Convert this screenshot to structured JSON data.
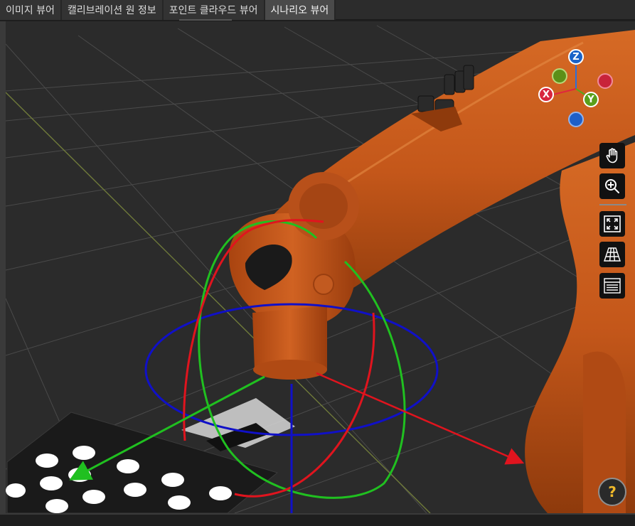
{
  "tabs": [
    {
      "label": "이미지 뷰어",
      "active": false
    },
    {
      "label": "캘리브레이션 원 정보",
      "active": false
    },
    {
      "label": "포인트 클라우드 뷰어",
      "active": false
    },
    {
      "label": "시나리오 뷰어",
      "active": true
    }
  ],
  "gizmo": {
    "z_label": "Z",
    "x_label": "X",
    "y_label": "Y"
  },
  "toolbar": [
    {
      "name": "pan-tool-button",
      "icon": "hand-icon"
    },
    {
      "name": "zoom-tool-button",
      "icon": "zoom-in-icon"
    },
    {
      "name": "fit-view-button",
      "icon": "fit-screen-icon"
    },
    {
      "name": "grid-toggle-button",
      "icon": "grid-floor-icon"
    },
    {
      "name": "properties-button",
      "icon": "list-panel-icon"
    }
  ],
  "help": {
    "label": "?"
  },
  "colors": {
    "robot": "#c4571a",
    "axis_x": "#e0141e",
    "axis_y": "#20c020",
    "axis_z": "#1010c8",
    "accent": "#f0b92a"
  }
}
